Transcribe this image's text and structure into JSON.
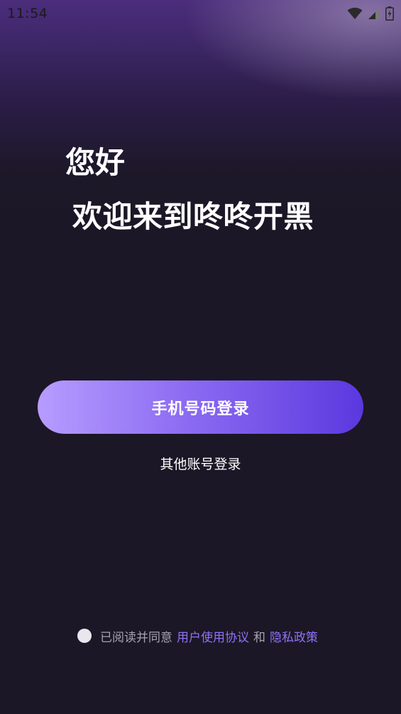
{
  "status_bar": {
    "time": "11:54",
    "icons": [
      "wifi-icon",
      "cellular-signal-icon",
      "battery-charging-icon"
    ]
  },
  "hero": {
    "greeting": "您好",
    "welcome": "欢迎来到咚咚开黑"
  },
  "login": {
    "phone_button_label": "手机号码登录",
    "other_login_label": "其他账号登录"
  },
  "agreement": {
    "prefix": "已阅读并同意",
    "user_agreement": "用户使用协议",
    "conjunction": "和",
    "privacy_policy": "隐私政策"
  },
  "colors": {
    "background": "#1b1726",
    "header_purple": "#4b2d7c",
    "button_gradient_start": "#b79cff",
    "button_gradient_end": "#5a38df",
    "link": "#8e72f5"
  }
}
